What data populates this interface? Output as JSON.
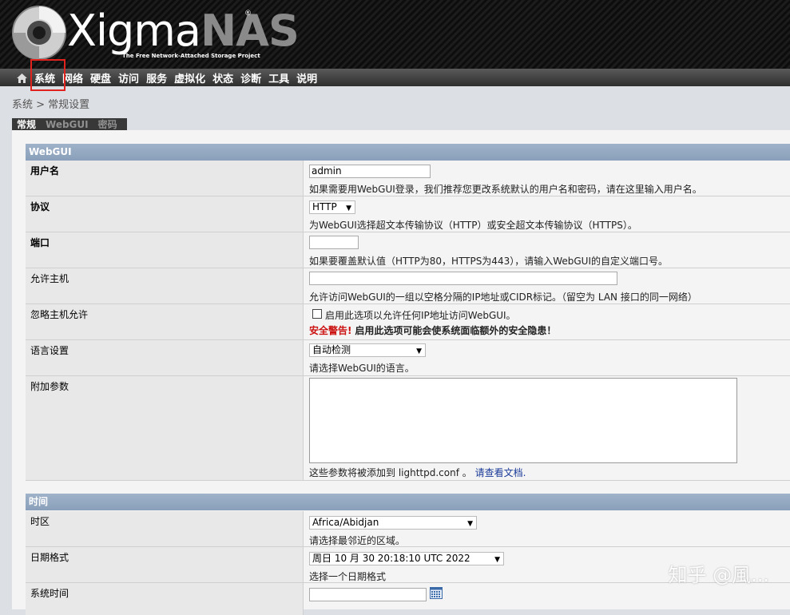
{
  "header": {
    "logo_word_1": "Xigma",
    "logo_word_2": "NAS",
    "logo_reg": "®",
    "logo_tagline": "The Free Network-Attached Storage Project"
  },
  "nav": {
    "items": [
      "系统",
      "网络",
      "硬盘",
      "访问",
      "服务",
      "虚拟化",
      "状态",
      "诊断",
      "工具",
      "说明"
    ]
  },
  "breadcrumb": "系统 > 常规设置",
  "tabs": [
    "常规",
    "WebGUI",
    "密码"
  ],
  "webgui": {
    "title": "WebGUI",
    "username_label": "用户名",
    "username_value": "admin",
    "username_hint": "如果需要用WebGUI登录，我们推荐您更改系统默认的用户名和密码，请在这里输入用户名。",
    "protocol_label": "协议",
    "protocol_value": "HTTP",
    "protocol_hint": "为WebGUI选择超文本传输协议（HTTP）或安全超文本传输协议（HTTPS）。",
    "port_label": "端口",
    "port_value": "",
    "port_hint": "如果要覆盖默认值（HTTP为80，HTTPS为443），请输入WebGUI的自定义端口号。",
    "hosts_label": "允许主机",
    "hosts_value": "",
    "hosts_hint": "允许访问WebGUI的一组以空格分隔的IP地址或CIDR标记。（留空为 LAN 接口的同一网络）",
    "ignore_label": "忽略主机允许",
    "ignore_checkbox_label": "启用此选项以允许任何IP地址访问WebGUI。",
    "ignore_warn_prefix": "安全警告!",
    "ignore_warn_text": "启用此选项可能会使系统面临额外的安全隐患！",
    "lang_label": "语言设置",
    "lang_value": "自动检测",
    "lang_hint": "请选择WebGUI的语言。",
    "aux_label": "附加参数",
    "aux_value": "",
    "aux_hint": "这些参数将被添加到 lighttpd.conf 。",
    "aux_link": "请查看文档."
  },
  "time": {
    "title": "时间",
    "tz_label": "时区",
    "tz_value": "Africa/Abidjan",
    "tz_hint": "请选择最邻近的区域。",
    "date_label": "日期格式",
    "date_value": "周日 10 月 30 20:18:10 UTC 2022",
    "date_hint": "选择一个日期格式",
    "systime_label": "系统时间",
    "systime_value": ""
  },
  "watermark": "知乎 @風..."
}
